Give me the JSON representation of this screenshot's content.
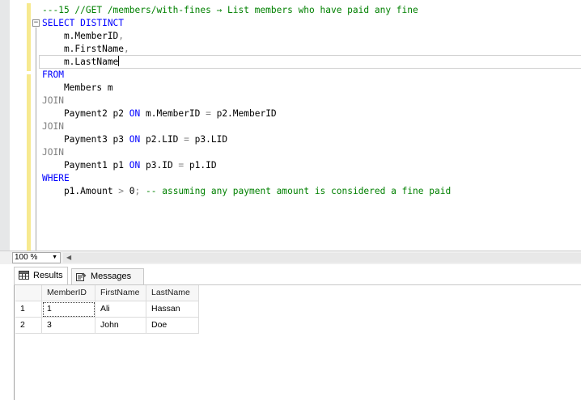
{
  "editor": {
    "lines": [
      {
        "parts": [
          {
            "t": "---15 //GET /members/with-fines → List members who have paid any fine",
            "c": "cmt"
          }
        ]
      },
      {
        "parts": [
          {
            "t": "SELECT DISTINCT",
            "c": "kw"
          }
        ]
      },
      {
        "parts": [
          {
            "t": "    m.MemberID",
            "c": ""
          },
          {
            "t": ",",
            "c": "gray"
          }
        ]
      },
      {
        "parts": [
          {
            "t": "    m.FirstName",
            "c": ""
          },
          {
            "t": ",",
            "c": "gray"
          }
        ]
      },
      {
        "parts": [
          {
            "t": "    m.LastName",
            "c": ""
          }
        ],
        "caret": true
      },
      {
        "parts": [
          {
            "t": "FROM",
            "c": "kw"
          }
        ]
      },
      {
        "parts": [
          {
            "t": "    Members m",
            "c": ""
          }
        ]
      },
      {
        "parts": [
          {
            "t": "JOIN",
            "c": "gray"
          }
        ]
      },
      {
        "parts": [
          {
            "t": "    Payment2 p2 ",
            "c": ""
          },
          {
            "t": "ON",
            "c": "kw"
          },
          {
            "t": " m.MemberID ",
            "c": ""
          },
          {
            "t": "=",
            "c": "gray"
          },
          {
            "t": " p2.MemberID",
            "c": ""
          }
        ]
      },
      {
        "parts": [
          {
            "t": "JOIN",
            "c": "gray"
          }
        ]
      },
      {
        "parts": [
          {
            "t": "    Payment3 p3 ",
            "c": ""
          },
          {
            "t": "ON",
            "c": "kw"
          },
          {
            "t": " p2.LID ",
            "c": ""
          },
          {
            "t": "=",
            "c": "gray"
          },
          {
            "t": " p3.LID",
            "c": ""
          }
        ]
      },
      {
        "parts": [
          {
            "t": "JOIN",
            "c": "gray"
          }
        ]
      },
      {
        "parts": [
          {
            "t": "    Payment1 p1 ",
            "c": ""
          },
          {
            "t": "ON",
            "c": "kw"
          },
          {
            "t": " p3.ID ",
            "c": ""
          },
          {
            "t": "=",
            "c": "gray"
          },
          {
            "t": " p1.ID",
            "c": ""
          }
        ]
      },
      {
        "parts": [
          {
            "t": "WHERE",
            "c": "kw"
          }
        ]
      },
      {
        "parts": [
          {
            "t": "    p1.Amount ",
            "c": ""
          },
          {
            "t": ">",
            "c": "gray"
          },
          {
            "t": " 0",
            "c": ""
          },
          {
            "t": ";",
            "c": "gray"
          },
          {
            "t": " -- assuming any payment amount is considered a fine paid",
            "c": "cmt"
          }
        ]
      }
    ],
    "collapse_glyph": "−"
  },
  "zoom": {
    "value": "100 %",
    "arrow": "▼"
  },
  "tabs": {
    "results": "Results",
    "messages": "Messages"
  },
  "grid": {
    "columns": [
      "MemberID",
      "FirstName",
      "LastName"
    ],
    "rows": [
      {
        "num": "1",
        "cells": [
          "1",
          "Ali",
          "Hassan"
        ]
      },
      {
        "num": "2",
        "cells": [
          "3",
          "John",
          "Doe"
        ]
      }
    ]
  },
  "colors": {
    "keyword": "#0000ff",
    "comment": "#008000",
    "operator": "#808080",
    "change_bar": "#f7e98f"
  }
}
